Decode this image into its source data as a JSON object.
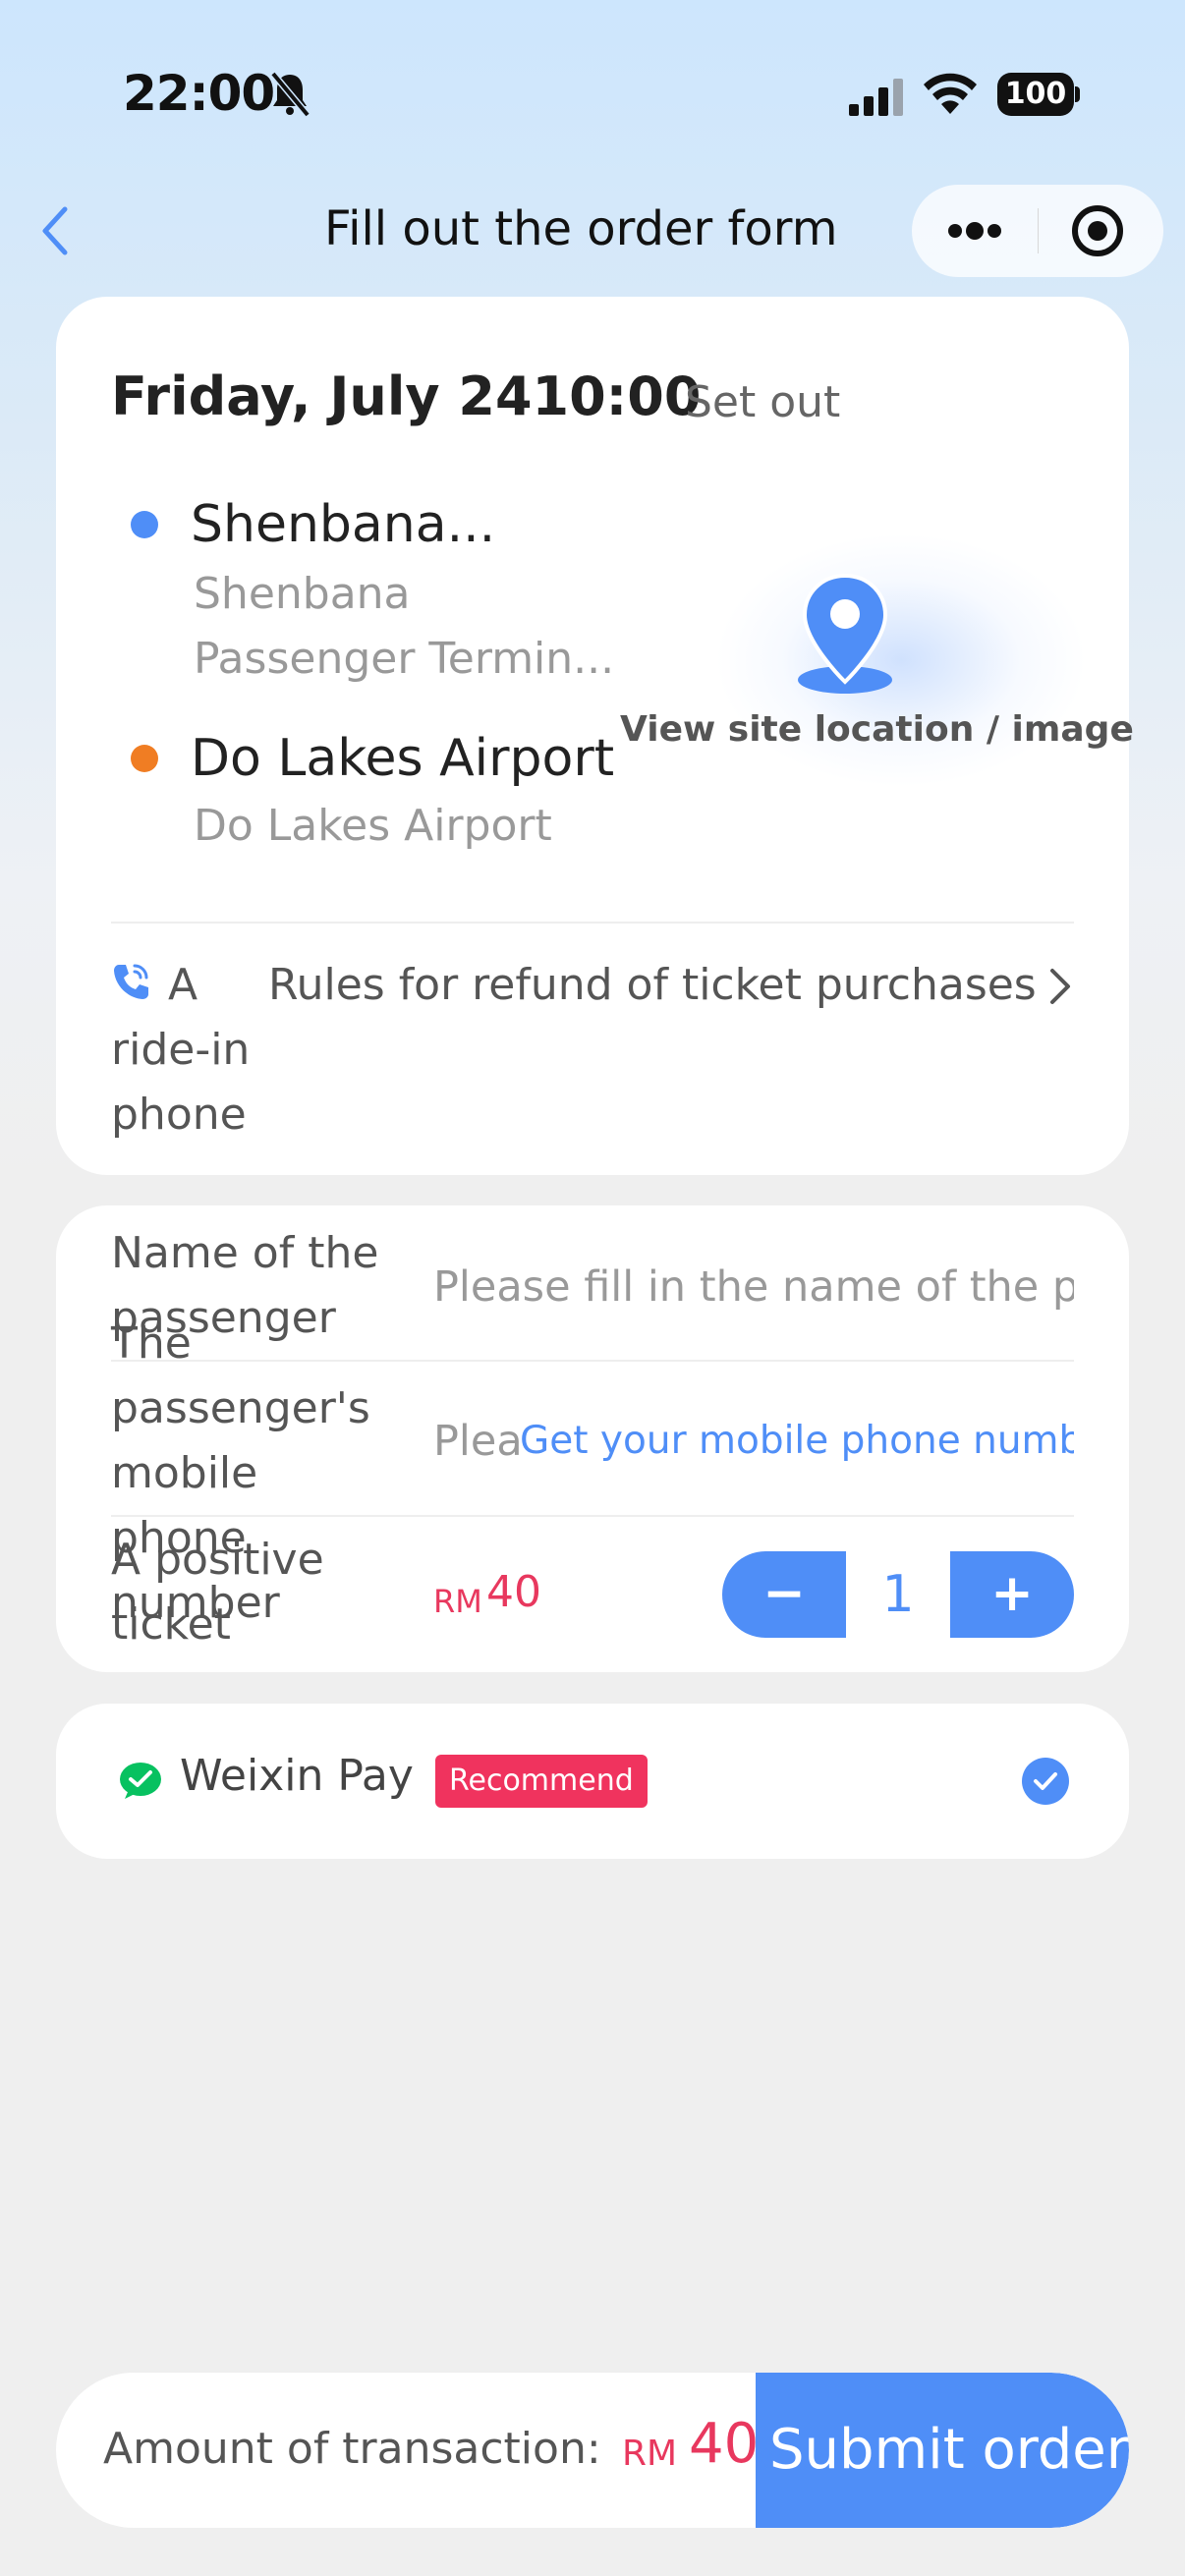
{
  "status_bar": {
    "time": "22:00",
    "battery": "100",
    "icons": [
      "bell-slash-icon",
      "signal-icon",
      "wifi-icon",
      "battery-icon"
    ]
  },
  "nav": {
    "title": "Fill out the order form",
    "back_icon": "chevron-left-icon",
    "more_icon": "more-dots-icon",
    "close_icon": "target-close-icon"
  },
  "trip": {
    "date_time": "Friday, July 2410:00",
    "set_out": "Set out",
    "origin": {
      "name": "Shenbana...",
      "sub": "Shenbana Passenger Termin..."
    },
    "destination": {
      "name": "Do Lakes Airport",
      "sub": "Do Lakes Airport"
    },
    "location_link": "View site location / image",
    "ride_in_phone": "A ride-in phone",
    "refund_rules": "Rules for refund of ticket purchases"
  },
  "passenger": {
    "name_label": "Name of the passenger",
    "name_placeholder": "Please fill in the name of the passenger",
    "phone_label": "The passenger's mobile phone number",
    "phone_placeholder": "Please",
    "get_phone": "Get your mobile phone number",
    "ticket_label": "A positive ticket",
    "ticket_currency": "RM",
    "ticket_price": "40",
    "minus": "−",
    "quantity": "1",
    "plus": "+"
  },
  "payment": {
    "method": "Weixin Pay",
    "badge": "Recommend",
    "selected": true
  },
  "bottom": {
    "amount_label": "Amount of transaction:",
    "currency": "RM",
    "amount": "40",
    "submit": "Submit order"
  },
  "colors": {
    "accent": "#4f8ef7",
    "price": "#e8385e",
    "origin_dot": "#4f8ef7",
    "destination_dot": "#f07d23",
    "badge": "#f0335e",
    "wechat": "#07c160"
  }
}
